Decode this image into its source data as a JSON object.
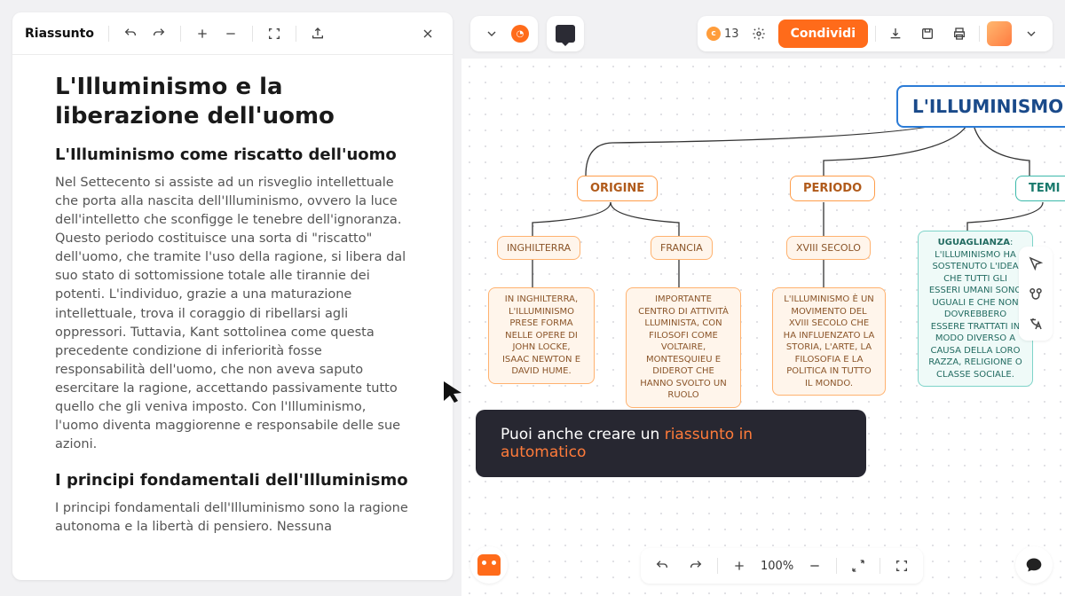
{
  "panel": {
    "title": "Riassunto",
    "article": {
      "title": "L'Illuminismo e la liberazione dell'uomo",
      "h2a": "L'Illuminismo come riscatto dell'uomo",
      "p1": "Nel Settecento si assiste ad un risveglio intellettuale che porta alla nascita dell'Illuminismo, ovvero la luce dell'intelletto che sconfigge le tenebre dell'ignoranza. Questo periodo costituisce una sorta di \"riscatto\" dell'uomo, che tramite l'uso della ragione, si libera dal suo stato di sottomissione totale alle tirannie dei potenti. L'individuo, grazie a una maturazione intellettuale, trova il coraggio di ribellarsi agli oppressori. Tuttavia, Kant sottolinea come questa precedente condizione di inferiorità fosse responsabilità dell'uomo, che non aveva saputo esercitare la ragione, accettando passivamente tutto quello che gli veniva imposto. Con l'Illuminismo, l'uomo diventa maggiorenne e responsabile delle sue azioni.",
      "h2b": "I principi fondamentali dell'Illuminismo",
      "p2": "I principi fondamentali dell'Illuminismo sono la ragione autonoma e la libertà di pensiero. Nessuna"
    }
  },
  "topbar": {
    "credits": "13",
    "share": "Condividi"
  },
  "map": {
    "root": "L'ILLUMINISMO",
    "origine": "ORIGINE",
    "periodo": "PERIODO",
    "temi": "TEMI",
    "inghilterra": "INGHILTERRA",
    "francia": "FRANCIA",
    "xviii": "XVIII SECOLO",
    "ugu_head": "UGUAGLIANZA",
    "ugu_body": ": L'ILLUMINISMO HA SOSTENUTO L'IDEA CHE TUTTI GLI ESSERI UMANI SONO UGUALI E CHE NON DOVREBBERO ESSERE TRATTATI IN MODO DIVERSO A CAUSA DELLA LORO RAZZA, RELIGIONE O CLASSE SOCIALE.",
    "ing_body": "IN INGHILTERRA, L'ILLUMINISMO PRESE FORMA NELLE OPERE DI JOHN LOCKE, ISAAC NEWTON E DAVID HUME.",
    "fra_body": "IMPORTANTE CENTRO DI ATTIVITÀ LLUMINISTA, CON FILOSOFI COME VOLTAIRE, MONTESQUIEU E DIDEROT CHE HANNO SVOLTO UN RUOLO",
    "per_body": "L'ILLUMINISMO È UN MOVIMENTO DEL XVIII SECOLO CHE HA INFLUENZATO LA STORIA, L'ARTE, LA FILOSOFIA E LA POLITICA IN TUTTO IL MONDO."
  },
  "tooltip": {
    "a": "Puoi anche creare un ",
    "b": "riassunto in automatico"
  },
  "zoom": "100%"
}
